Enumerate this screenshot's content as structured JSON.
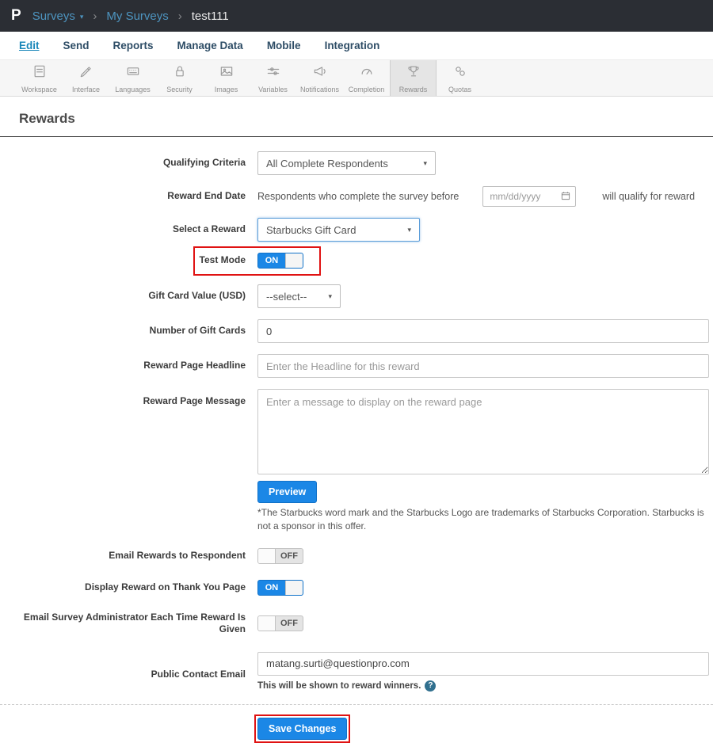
{
  "colors": {
    "accent": "#1b87e6",
    "annotation_red": "#e01212",
    "topbar_bg": "#2b2e34",
    "link_blue": "#4d94bf"
  },
  "icons": {
    "caret": "▾",
    "chevron": "›",
    "help": "?",
    "dropdown_caret": "▾"
  },
  "topbar": {
    "logo": "P",
    "product": "Surveys",
    "breadcrumbs": {
      "level1": "My Surveys",
      "current": "test111"
    }
  },
  "nav": {
    "items": [
      "Edit",
      "Send",
      "Reports",
      "Manage Data",
      "Mobile",
      "Integration"
    ],
    "active": "Edit"
  },
  "toolbar": {
    "active": "Rewards",
    "items": [
      {
        "label": "Workspace"
      },
      {
        "label": "Interface"
      },
      {
        "label": "Languages"
      },
      {
        "label": "Security"
      },
      {
        "label": "Images"
      },
      {
        "label": "Variables"
      },
      {
        "label": "Notifications"
      },
      {
        "label": "Completion"
      },
      {
        "label": "Rewards"
      },
      {
        "label": "Quotas"
      }
    ]
  },
  "page": {
    "title": "Rewards"
  },
  "form": {
    "qualifying_criteria": {
      "label": "Qualifying Criteria",
      "value": "All Complete Respondents"
    },
    "reward_end_date": {
      "label": "Reward End Date",
      "prefix": "Respondents who complete the survey before",
      "placeholder": "mm/dd/yyyy",
      "suffix": "will qualify for reward"
    },
    "select_reward": {
      "label": "Select a Reward",
      "value": "Starbucks Gift Card"
    },
    "test_mode": {
      "label": "Test Mode",
      "state": "ON"
    },
    "gift_card_value": {
      "label": "Gift Card Value (USD)",
      "value": "--select--"
    },
    "number_of_gift_cards": {
      "label": "Number of Gift Cards",
      "value": "0"
    },
    "reward_page_headline": {
      "label": "Reward Page Headline",
      "placeholder": "Enter the Headline for this reward"
    },
    "reward_page_message": {
      "label": "Reward Page Message",
      "placeholder": "Enter a message to display on the reward page"
    },
    "preview_button": "Preview",
    "disclaimer": "*The Starbucks word mark and the Starbucks Logo are trademarks of Starbucks Corporation. Starbucks is not a sponsor in this offer.",
    "email_rewards_to_respondent": {
      "label": "Email Rewards to Respondent",
      "state": "OFF"
    },
    "display_reward_on_thank_you_page": {
      "label": "Display Reward on Thank You Page",
      "state": "ON"
    },
    "email_survey_admin": {
      "label": "Email Survey Administrator Each Time Reward Is Given",
      "state": "OFF"
    },
    "public_contact_email": {
      "label": "Public Contact Email",
      "value": "matang.surti@questionpro.com",
      "helper": "This will be shown to reward winners."
    },
    "save_button": "Save Changes"
  }
}
